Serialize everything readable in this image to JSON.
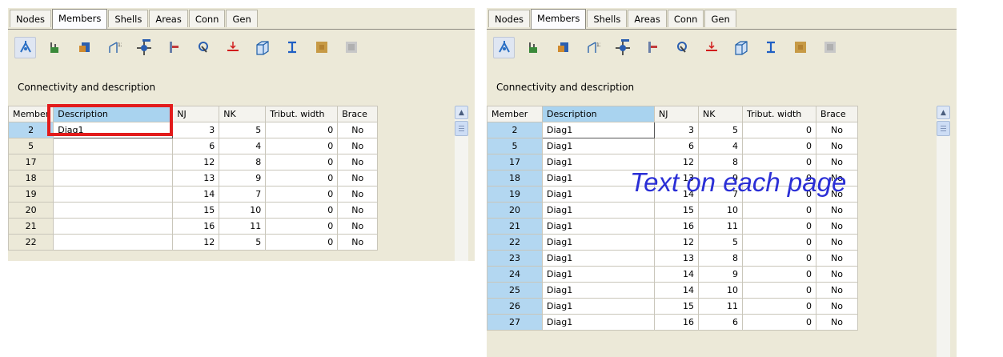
{
  "tabs": [
    "Nodes",
    "Members",
    "Shells",
    "Areas",
    "Conn",
    "Gen"
  ],
  "active_tab": "Members",
  "toolbar_icons": [
    {
      "name": "member-select-icon",
      "color": "#2a6fc4"
    },
    {
      "name": "member-supports-icon",
      "color": "#3a8a3a"
    },
    {
      "name": "member-section-icon",
      "color": "#2b5fb0"
    },
    {
      "name": "member-releases-icon",
      "color": "#3a6fb0"
    },
    {
      "name": "member-offsets-icon",
      "color": "#2b5fb0"
    },
    {
      "name": "member-orientation-icon",
      "color": "#c23b3b"
    },
    {
      "name": "member-design-icon",
      "color": "#2b5fb0"
    },
    {
      "name": "member-loads-icon",
      "color": "#d11c1c"
    },
    {
      "name": "member-3d-icon",
      "color": "#1f5fa8"
    },
    {
      "name": "member-ibeam-icon",
      "color": "#1f5fc4"
    },
    {
      "name": "member-material-icon",
      "color": "#b98a3a"
    },
    {
      "name": "member-disabled-icon",
      "color": "#a9a9a9"
    }
  ],
  "section_title": "Connectivity and description",
  "columns": [
    "Member",
    "Description",
    "NJ",
    "NK",
    "Tribut. width",
    "Brace"
  ],
  "left_rows": [
    {
      "member": "2",
      "description": "Diag1",
      "nj": "3",
      "nk": "5",
      "tribut_width": "0",
      "brace": "No"
    },
    {
      "member": "5",
      "description": "",
      "nj": "6",
      "nk": "4",
      "tribut_width": "0",
      "brace": "No"
    },
    {
      "member": "17",
      "description": "",
      "nj": "12",
      "nk": "8",
      "tribut_width": "0",
      "brace": "No"
    },
    {
      "member": "18",
      "description": "",
      "nj": "13",
      "nk": "9",
      "tribut_width": "0",
      "brace": "No"
    },
    {
      "member": "19",
      "description": "",
      "nj": "14",
      "nk": "7",
      "tribut_width": "0",
      "brace": "No"
    },
    {
      "member": "20",
      "description": "",
      "nj": "15",
      "nk": "10",
      "tribut_width": "0",
      "brace": "No"
    },
    {
      "member": "21",
      "description": "",
      "nj": "16",
      "nk": "11",
      "tribut_width": "0",
      "brace": "No"
    },
    {
      "member": "22",
      "description": "",
      "nj": "12",
      "nk": "5",
      "tribut_width": "0",
      "brace": "No"
    }
  ],
  "right_rows": [
    {
      "member": "2",
      "description": "Diag1",
      "nj": "3",
      "nk": "5",
      "tribut_width": "0",
      "brace": "No"
    },
    {
      "member": "5",
      "description": "Diag1",
      "nj": "6",
      "nk": "4",
      "tribut_width": "0",
      "brace": "No"
    },
    {
      "member": "17",
      "description": "Diag1",
      "nj": "12",
      "nk": "8",
      "tribut_width": "0",
      "brace": "No"
    },
    {
      "member": "18",
      "description": "Diag1",
      "nj": "13",
      "nk": "9",
      "tribut_width": "0",
      "brace": "No"
    },
    {
      "member": "19",
      "description": "Diag1",
      "nj": "14",
      "nk": "7",
      "tribut_width": "0",
      "brace": "No"
    },
    {
      "member": "20",
      "description": "Diag1",
      "nj": "15",
      "nk": "10",
      "tribut_width": "0",
      "brace": "No"
    },
    {
      "member": "21",
      "description": "Diag1",
      "nj": "16",
      "nk": "11",
      "tribut_width": "0",
      "brace": "No"
    },
    {
      "member": "22",
      "description": "Diag1",
      "nj": "12",
      "nk": "5",
      "tribut_width": "0",
      "brace": "No"
    },
    {
      "member": "23",
      "description": "Diag1",
      "nj": "13",
      "nk": "8",
      "tribut_width": "0",
      "brace": "No"
    },
    {
      "member": "24",
      "description": "Diag1",
      "nj": "14",
      "nk": "9",
      "tribut_width": "0",
      "brace": "No"
    },
    {
      "member": "25",
      "description": "Diag1",
      "nj": "14",
      "nk": "10",
      "tribut_width": "0",
      "brace": "No"
    },
    {
      "member": "26",
      "description": "Diag1",
      "nj": "15",
      "nk": "11",
      "tribut_width": "0",
      "brace": "No"
    },
    {
      "member": "27",
      "description": "Diag1",
      "nj": "16",
      "nk": "6",
      "tribut_width": "0",
      "brace": "No"
    }
  ],
  "overlay_text": "Text on each page",
  "colors": {
    "highlight": "#e21b1b",
    "overlay_text": "#2b2fd6",
    "selected_header": "#a9d3ef"
  }
}
